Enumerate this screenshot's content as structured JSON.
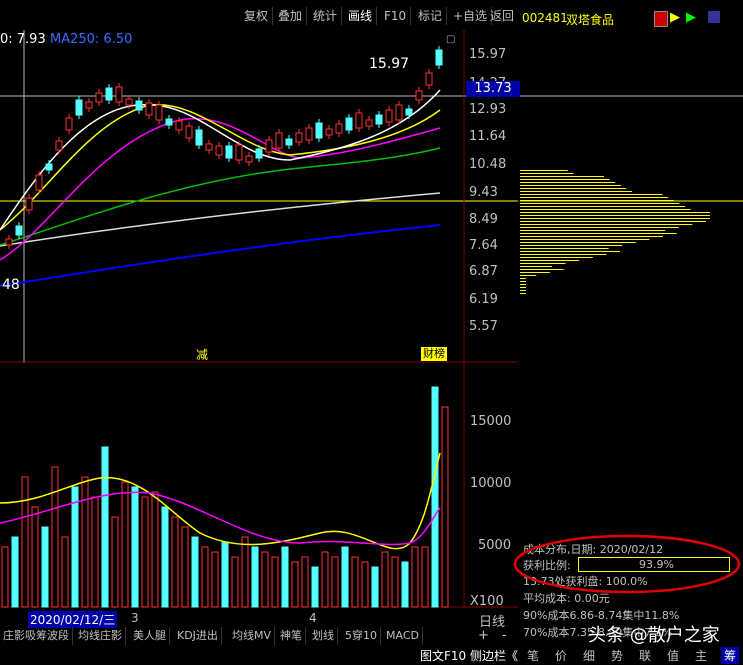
{
  "toolbar": {
    "buttons": [
      "复权",
      "叠加",
      "统计",
      "画线",
      "F10",
      "标记",
      "+自选",
      "返回"
    ]
  },
  "stock": {
    "code": "002481",
    "name": "双塔食品"
  },
  "ma_label": {
    "prefix": "0: 7.93",
    "ma250": "MA250: 6.50"
  },
  "price_axis": [
    "15.97",
    "14.27",
    "12.93",
    "11.64",
    "10.48",
    "9.43",
    "8.49",
    "7.64",
    "6.87",
    "6.19",
    "5.57"
  ],
  "current_price": "13.73",
  "high_label": "15.97",
  "left_price_label": "48",
  "markers": {
    "jian": "减",
    "caibang": "财榜"
  },
  "volume_axis": [
    "15000",
    "10000",
    "5000",
    "X100"
  ],
  "date_bar": {
    "date": "2020/02/12/三",
    "mark3": "3",
    "mark4": "4",
    "period": "日线"
  },
  "bottom_tabs": [
    "庄影吸筹波段",
    "均线庄影",
    "美人腿",
    "KDJ进出",
    "均线MV",
    "神笔",
    "划线",
    "5穿10",
    "MACD"
  ],
  "zoom": [
    "+",
    "-"
  ],
  "bottom_bar": [
    "图文F10",
    "侧边栏《",
    "笔",
    "价",
    "细",
    "势",
    "联",
    "值",
    "主",
    "筹"
  ],
  "chip_info": {
    "title": "成本分布,日期: 2020/02/12",
    "profit_label": "获利比例:",
    "profit_value": "93.9%",
    "profit_fill": 0.939,
    "line2": "13.73处获利盘: 100.0%",
    "line3": "平均成本: 0.00元",
    "line4": "90%成本6.86-8.74集中11.8%",
    "line5": "70%成本7.35-8.49集中7.3%"
  },
  "watermark": "头条 @散户之家",
  "colors": {
    "up": "#ff3232",
    "down": "#54ffff",
    "yellow": "#ffff00",
    "ma_white": "#ffffff",
    "ma_magenta": "#ff00ff",
    "ma_green": "#00ff00",
    "ma_blue": "#0000ff"
  }
}
